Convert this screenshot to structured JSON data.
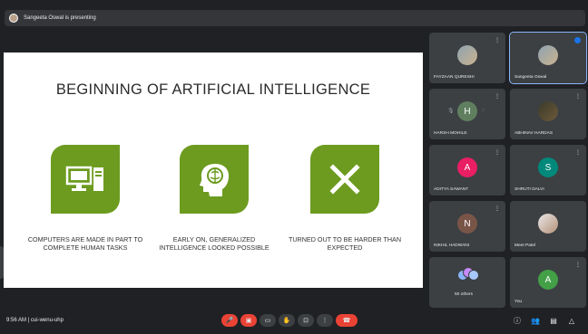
{
  "presenting": {
    "text": "Sangeeta Oswal is presenting"
  },
  "slide": {
    "title": "BEGINNING OF ARTIFICIAL INTELLIGENCE",
    "items": [
      {
        "icon": "computer-icon",
        "caption": "COMPUTERS ARE MADE IN PART TO COMPLETE HUMAN TASKS"
      },
      {
        "icon": "brain-head-icon",
        "caption": "EARLY ON, GENERALIZED INTELLIGENCE LOOKED POSSIBLE"
      },
      {
        "icon": "x-mark-icon",
        "caption": "TURNED OUT TO BE HARDER THAN EXPECTED"
      }
    ],
    "accent_color": "#6c9b1f"
  },
  "participants": [
    {
      "name": "FAYZAAN QURESHI",
      "initial": ""
    },
    {
      "name": "Sangeeta Oswal",
      "initial": ""
    },
    {
      "name": "HARSH MOHILE",
      "initial": "H"
    },
    {
      "name": "ABHINAV HARDAS",
      "initial": ""
    },
    {
      "name": "ADITYA SAWANT",
      "initial": "A"
    },
    {
      "name": "SHRUTI DALVI",
      "initial": "S"
    },
    {
      "name": "NIKHIL HADWANI",
      "initial": "N"
    },
    {
      "name": "Meet Patel",
      "initial": ""
    },
    {
      "name": "50 others",
      "initial": ""
    },
    {
      "name": "You",
      "initial": "A"
    }
  ],
  "footer": {
    "time_code": "9:56 AM  |  cui-wenu-uhp"
  }
}
